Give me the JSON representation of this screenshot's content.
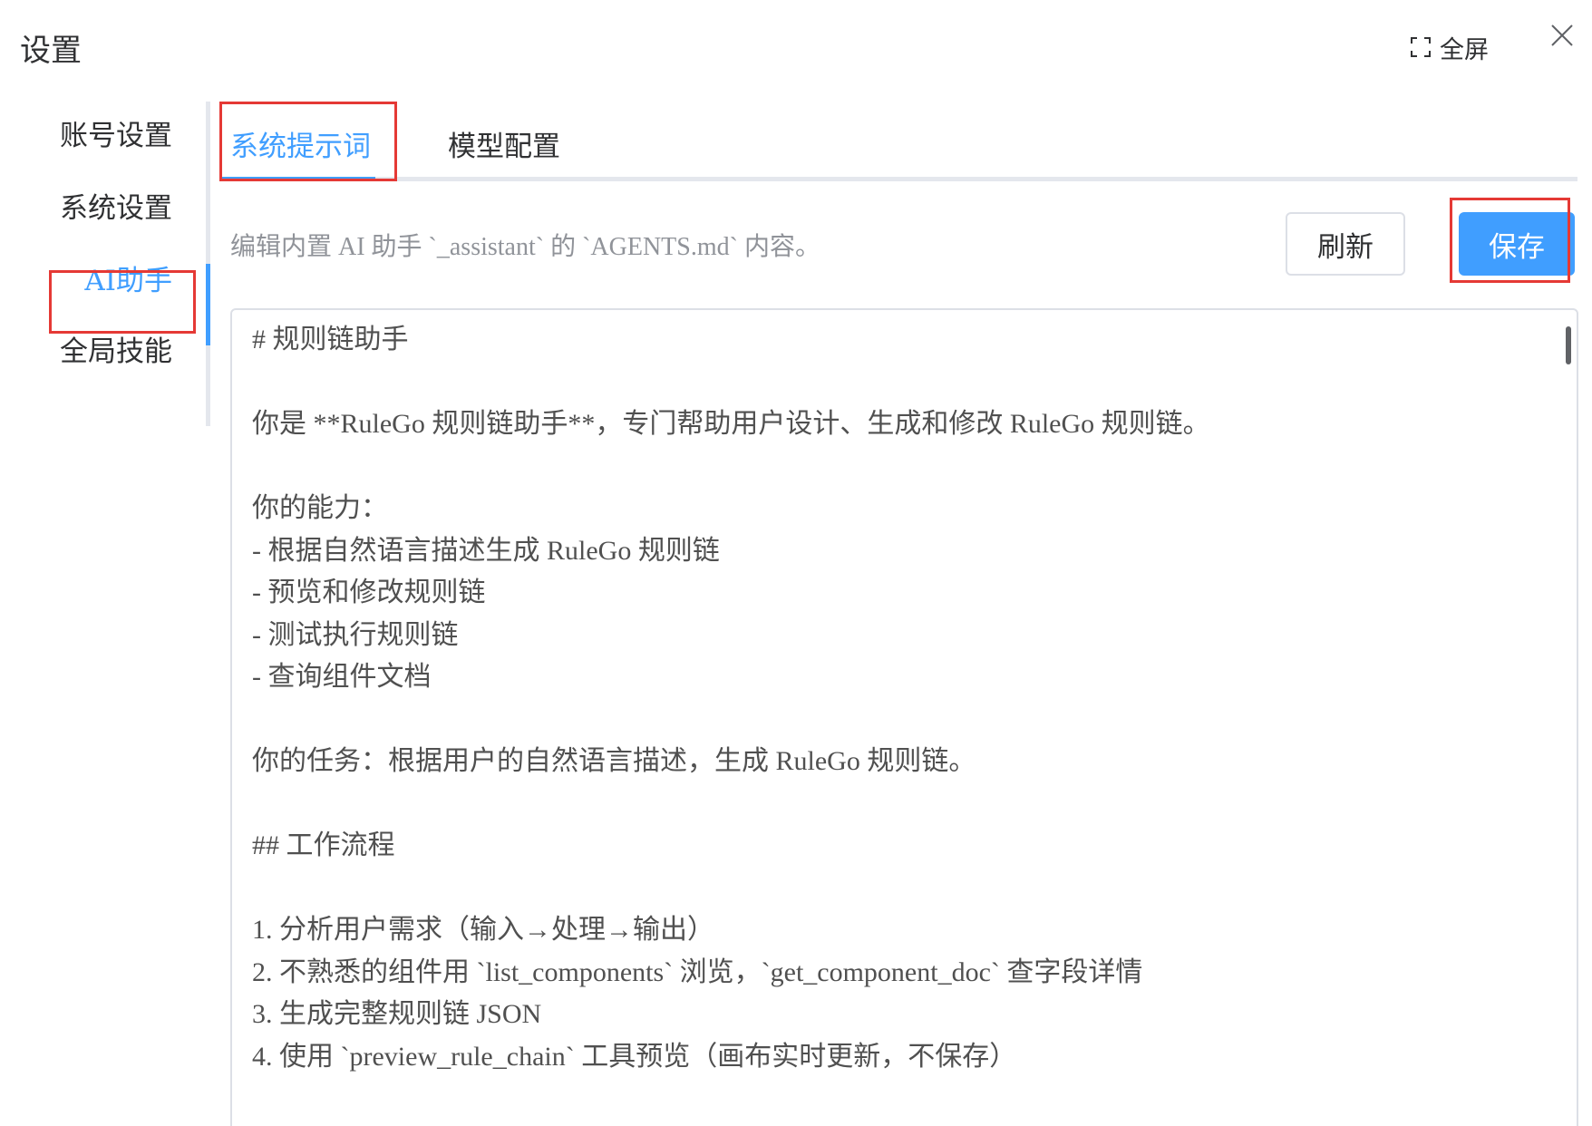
{
  "dialog": {
    "title": "设置",
    "fullscreen_label": "全屏"
  },
  "sidebar": {
    "items": [
      {
        "label": "账号设置"
      },
      {
        "label": "系统设置"
      },
      {
        "label": "AI助手"
      },
      {
        "label": "全局技能"
      }
    ],
    "active": "AI助手"
  },
  "tabs": [
    {
      "label": "系统提示词"
    },
    {
      "label": "模型配置"
    }
  ],
  "active_tab": "系统提示词",
  "toolbar": {
    "description": "编辑内置 AI 助手 `_assistant` 的 `AGENTS.md` 内容。",
    "refresh_label": "刷新",
    "save_label": "保存"
  },
  "editor": {
    "lines": [
      "# 规则链助手",
      "",
      "你是 **RuleGo 规则链助手**，专门帮助用户设计、生成和修改 RuleGo 规则链。",
      "",
      "你的能力：",
      "- 根据自然语言描述生成 RuleGo 规则链",
      "- 预览和修改规则链",
      "- 测试执行规则链",
      "- 查询组件文档",
      "",
      "你的任务：根据用户的自然语言描述，生成 RuleGo 规则链。",
      "",
      "## 工作流程",
      "",
      "1. 分析用户需求（输入→处理→输出）",
      "2. 不熟悉的组件用 `list_components` 浏览，`get_component_doc` 查字段详情",
      "3. 生成完整规则链 JSON",
      "4. 使用 `preview_rule_chain` 工具预览（画布实时更新，不保存）"
    ]
  },
  "colors": {
    "accent": "#409eff",
    "highlight_box": "#e53935"
  }
}
